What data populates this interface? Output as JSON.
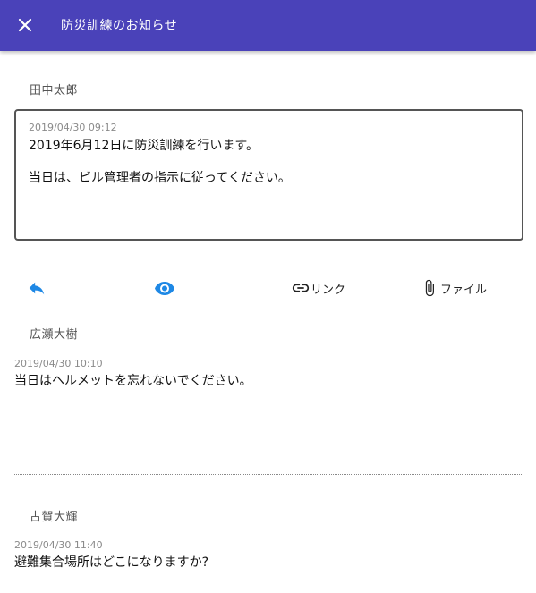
{
  "header": {
    "title": "防災訓練のお知らせ",
    "close_icon": "close-icon",
    "background": "#4a42b9"
  },
  "post": {
    "author": "田中太郎",
    "timestamp": "2019/04/30 09:12",
    "lines": [
      "2019年6月12日に防災訓練を行います。",
      "当日は、ビル管理者の指示に従ってください。"
    ]
  },
  "actions": {
    "reply_icon": "reply-icon",
    "view_icon": "eye-icon",
    "link_label": "リンク",
    "file_label": "ファイル",
    "accent": "#1e88e5"
  },
  "comments": [
    {
      "author": "広瀬大樹",
      "timestamp": "2019/04/30 10:10",
      "body": "当日はヘルメットを忘れないでください。"
    },
    {
      "author": "古賀大輝",
      "timestamp": "2019/04/30 11:40",
      "body": "避難集合場所はどこになりますか?"
    }
  ]
}
